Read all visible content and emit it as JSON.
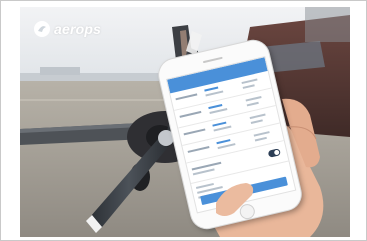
{
  "brand": {
    "name": "aerops",
    "logo_color": "#ffffff"
  },
  "photo": {
    "subject": "photograph",
    "icons": [
      "aerops-logo-icon"
    ]
  },
  "app_screen": {
    "accent_color": "#4a90d9",
    "toggle_state": "on"
  },
  "colors": {
    "sky": "#e9ecef",
    "tarmac": "#a8a49c",
    "aircraft_body": "#5a3a34",
    "propeller": "#3b3f44"
  }
}
